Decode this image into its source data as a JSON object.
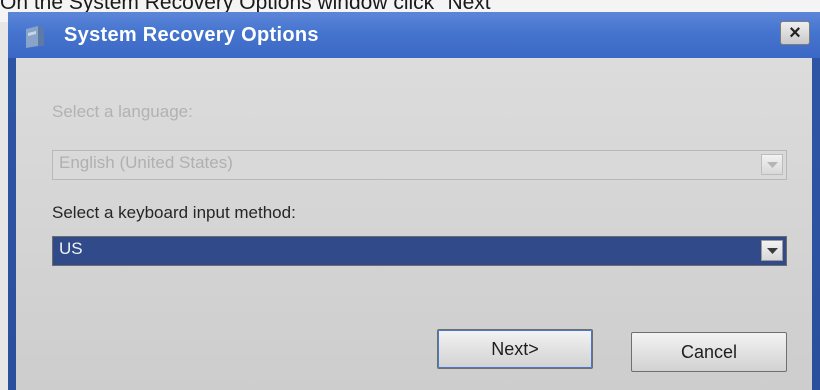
{
  "caption": "On the System Recovery Options window click \"Next\"",
  "window": {
    "title": "System Recovery Options",
    "close_label": "×"
  },
  "language": {
    "label": "Select a language:",
    "value": "English (United States)",
    "enabled": false
  },
  "keyboard": {
    "label": "Select a keyboard input method:",
    "value": "US",
    "enabled": true
  },
  "buttons": {
    "next": "Next>",
    "cancel": "Cancel"
  },
  "colors": {
    "titlebar": "#4574cf",
    "selection": "#304a8a"
  }
}
